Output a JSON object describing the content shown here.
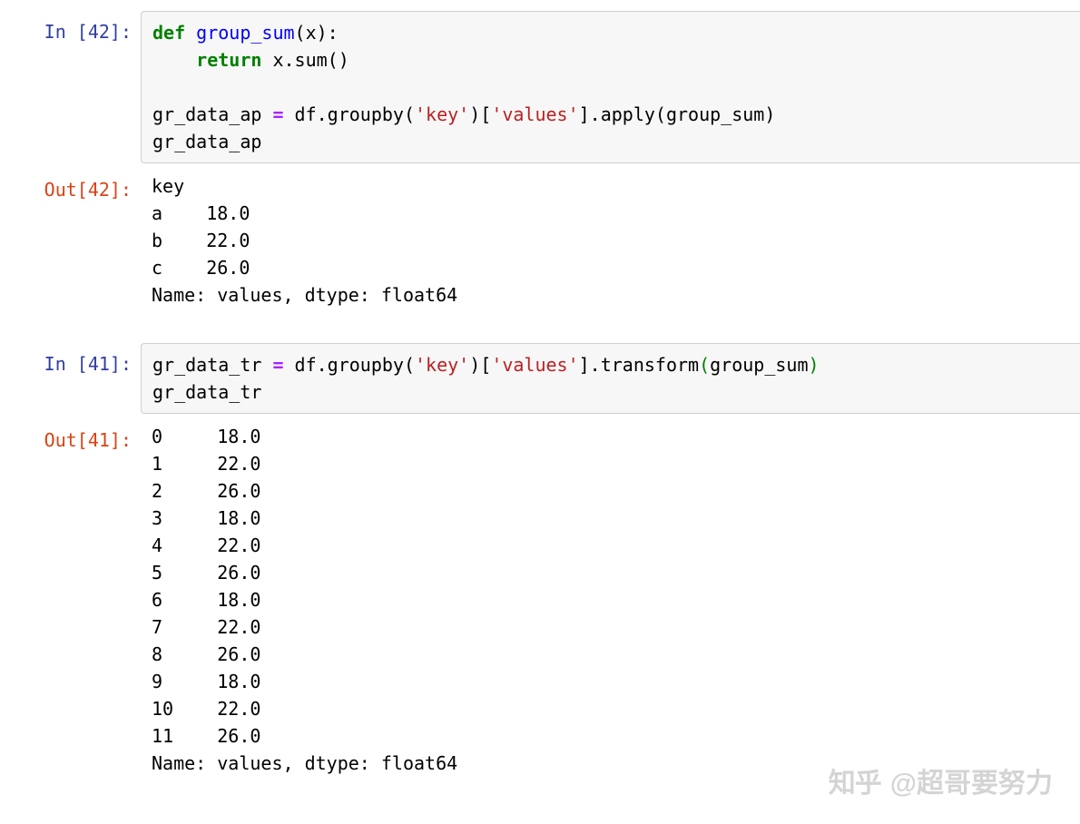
{
  "prompts": {
    "in42": "In [42]:",
    "out42": "Out[42]:",
    "in41": "In [41]:",
    "out41": "Out[41]:"
  },
  "code42": {
    "kw_def": "def",
    "fn_name": "group_sum",
    "fn_params_open": "(x):",
    "indent": "    ",
    "kw_return": "return",
    "ret_expr": " x.sum()",
    "blank": "",
    "l3_a": "gr_data_ap ",
    "op_eq": "=",
    "l3_b": " df.groupby(",
    "str_key": "'key'",
    "l3_c": ")[",
    "str_values": "'values'",
    "l3_d": "].apply(group_sum)",
    "l4": "gr_data_ap"
  },
  "out42_text": "key\na    18.0\nb    22.0\nc    26.0\nName: values, dtype: float64",
  "code41": {
    "l1_a": "gr_data_tr ",
    "op_eq": "=",
    "l1_b": " df.groupby(",
    "str_key": "'key'",
    "l1_c": ")[",
    "str_values": "'values'",
    "l1_d": "].transform",
    "paren_open": "(",
    "arg": "group_sum",
    "paren_close": ")",
    "l2": "gr_data_tr"
  },
  "out41_text": "0     18.0\n1     22.0\n2     26.0\n3     18.0\n4     22.0\n5     26.0\n6     18.0\n7     22.0\n8     26.0\n9     18.0\n10    22.0\n11    26.0\nName: values, dtype: float64",
  "watermark": {
    "logo": "知乎",
    "handle": "@超哥要努力"
  }
}
